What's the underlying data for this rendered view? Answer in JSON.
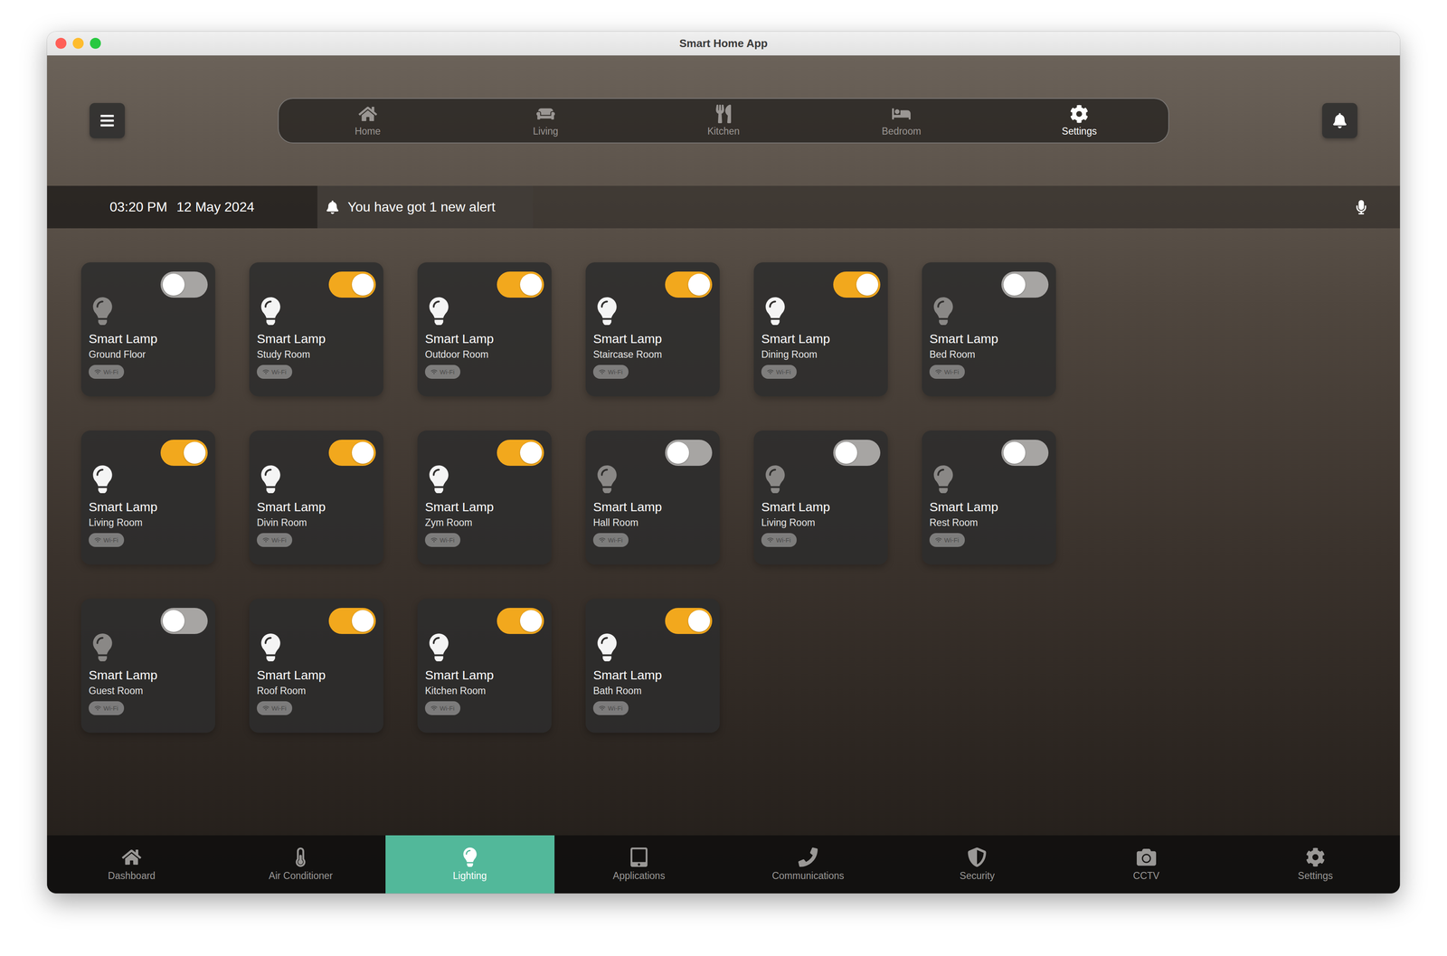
{
  "window": {
    "title": "Smart Home App"
  },
  "header": {
    "tabs": [
      {
        "label": "Home",
        "selected": false
      },
      {
        "label": "Living",
        "selected": false
      },
      {
        "label": "Kitchen",
        "selected": false
      },
      {
        "label": "Bedroom",
        "selected": false
      },
      {
        "label": "Settings",
        "selected": true
      }
    ]
  },
  "info_bar": {
    "time": "03:20 PM",
    "date": "12 May 2024",
    "alert": "You have got 1 new alert"
  },
  "lamps": [
    {
      "name": "Smart Lamp",
      "room": "Ground Floor",
      "badge": "Wi-Fi",
      "on": false
    },
    {
      "name": "Smart Lamp",
      "room": "Study Room",
      "badge": "Wi-Fi",
      "on": true
    },
    {
      "name": "Smart Lamp",
      "room": "Outdoor Room",
      "badge": "Wi-Fi",
      "on": true
    },
    {
      "name": "Smart Lamp",
      "room": "Staircase Room",
      "badge": "Wi-Fi",
      "on": true
    },
    {
      "name": "Smart Lamp",
      "room": "Dining Room",
      "badge": "Wi-Fi",
      "on": true
    },
    {
      "name": "Smart Lamp",
      "room": "Bed Room",
      "badge": "Wi-Fi",
      "on": false
    },
    {
      "name": "Smart Lamp",
      "room": "Living Room",
      "badge": "Wi-Fi",
      "on": true
    },
    {
      "name": "Smart Lamp",
      "room": "Divin Room",
      "badge": "Wi-Fi",
      "on": true
    },
    {
      "name": "Smart Lamp",
      "room": "Zym Room",
      "badge": "Wi-Fi",
      "on": true
    },
    {
      "name": "Smart Lamp",
      "room": "Hall Room",
      "badge": "Wi-Fi",
      "on": false
    },
    {
      "name": "Smart Lamp",
      "room": "Living Room",
      "badge": "Wi-Fi",
      "on": false
    },
    {
      "name": "Smart Lamp",
      "room": "Rest Room",
      "badge": "Wi-Fi",
      "on": false
    },
    {
      "name": "Smart Lamp",
      "room": "Guest Room",
      "badge": "Wi-Fi",
      "on": false
    },
    {
      "name": "Smart Lamp",
      "room": "Roof Room",
      "badge": "Wi-Fi",
      "on": true
    },
    {
      "name": "Smart Lamp",
      "room": "Kitchen Room",
      "badge": "Wi-Fi",
      "on": true
    },
    {
      "name": "Smart Lamp",
      "room": "Bath Room",
      "badge": "Wi-Fi",
      "on": true
    }
  ],
  "bottom_nav": [
    {
      "label": "Dashboard",
      "selected": false
    },
    {
      "label": "Air Conditioner",
      "selected": false
    },
    {
      "label": "Lighting",
      "selected": true
    },
    {
      "label": "Applications",
      "selected": false
    },
    {
      "label": "Communications",
      "selected": false
    },
    {
      "label": "Security",
      "selected": false
    },
    {
      "label": "CCTV",
      "selected": false
    },
    {
      "label": "Settings",
      "selected": false
    }
  ]
}
